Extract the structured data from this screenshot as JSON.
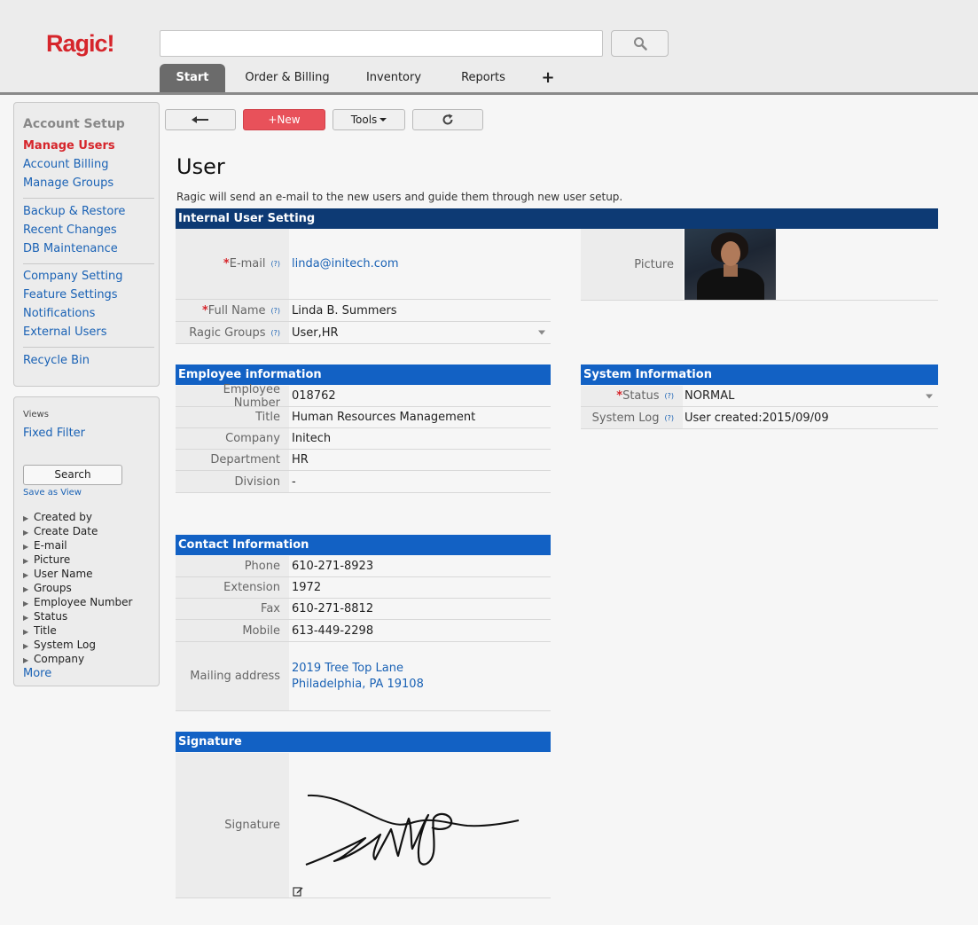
{
  "app": {
    "logo": "Ragic!"
  },
  "search": {
    "placeholder": ""
  },
  "tabs": [
    {
      "label": "Start"
    },
    {
      "label": "Order & Billing"
    },
    {
      "label": "Inventory"
    },
    {
      "label": "Reports"
    },
    {
      "label": "+"
    }
  ],
  "sidebar": {
    "heading": "Account Setup",
    "items": [
      {
        "label": "Manage Users"
      },
      {
        "label": "Account Billing"
      },
      {
        "label": "Manage Groups"
      },
      {
        "label": "Backup & Restore"
      },
      {
        "label": "Recent Changes"
      },
      {
        "label": "DB Maintenance"
      },
      {
        "label": "Company Setting"
      },
      {
        "label": "Feature Settings"
      },
      {
        "label": "Notifications"
      },
      {
        "label": "External Users"
      },
      {
        "label": "Recycle Bin"
      }
    ],
    "views_label": "Views",
    "fixed_filter": "Fixed Filter",
    "search_button": "Search",
    "save_as_view": "Save as View",
    "filters": [
      "Created by",
      "Create Date",
      "E-mail",
      "Picture",
      "User Name",
      "Groups",
      "Employee Number",
      "Status",
      "Title",
      "System Log",
      "Company"
    ],
    "more": "More"
  },
  "toolbar": {
    "back": "⟵",
    "new": "+New",
    "tools": "Tools",
    "refresh": "↻"
  },
  "page": {
    "title": "User",
    "description": "Ragic will send an e-mail to the new users and guide them through new user setup."
  },
  "sections": {
    "internal": {
      "title": "Internal User Setting",
      "email_label": "E-mail",
      "email_value": "linda@initech.com",
      "fullname_label": "Full Name",
      "fullname_value": "Linda B. Summers",
      "groups_label": "Ragic Groups",
      "groups_value": "User,HR",
      "picture_label": "Picture"
    },
    "employee": {
      "title": "Employee information",
      "rows": [
        {
          "label": "Employee Number",
          "value": "018762"
        },
        {
          "label": "Title",
          "value": "Human Resources Management"
        },
        {
          "label": "Company",
          "value": "Initech"
        },
        {
          "label": "Department",
          "value": "HR"
        },
        {
          "label": "Division",
          "value": "-"
        }
      ]
    },
    "system": {
      "title": "System Information",
      "status_label": "Status",
      "status_value": "NORMAL",
      "log_label": "System Log",
      "log_value": "User created:2015/09/09"
    },
    "contact": {
      "title": "Contact Information",
      "rows": [
        {
          "label": "Phone",
          "value": "610-271-8923"
        },
        {
          "label": "Extension",
          "value": "1972"
        },
        {
          "label": "Fax",
          "value": "610-271-8812"
        },
        {
          "label": "Mobile",
          "value": "613-449-2298"
        }
      ],
      "address_label": "Mailing address",
      "address_line1": "2019 Tree Top Lane",
      "address_line2": "Philadelphia, PA 19108"
    },
    "signature": {
      "title": "Signature",
      "label": "Signature"
    }
  },
  "help_mark": "(?)",
  "required_mark": "*",
  "icons": {
    "search": "search-icon",
    "back": "arrow-left-icon",
    "refresh": "refresh-icon",
    "edit": "edit-icon"
  },
  "colors": {
    "brand": "#d6252b",
    "section_dark": "#0d3a74",
    "section": "#1261c4",
    "link": "#1a62b5",
    "new_button": "#e8515a"
  }
}
